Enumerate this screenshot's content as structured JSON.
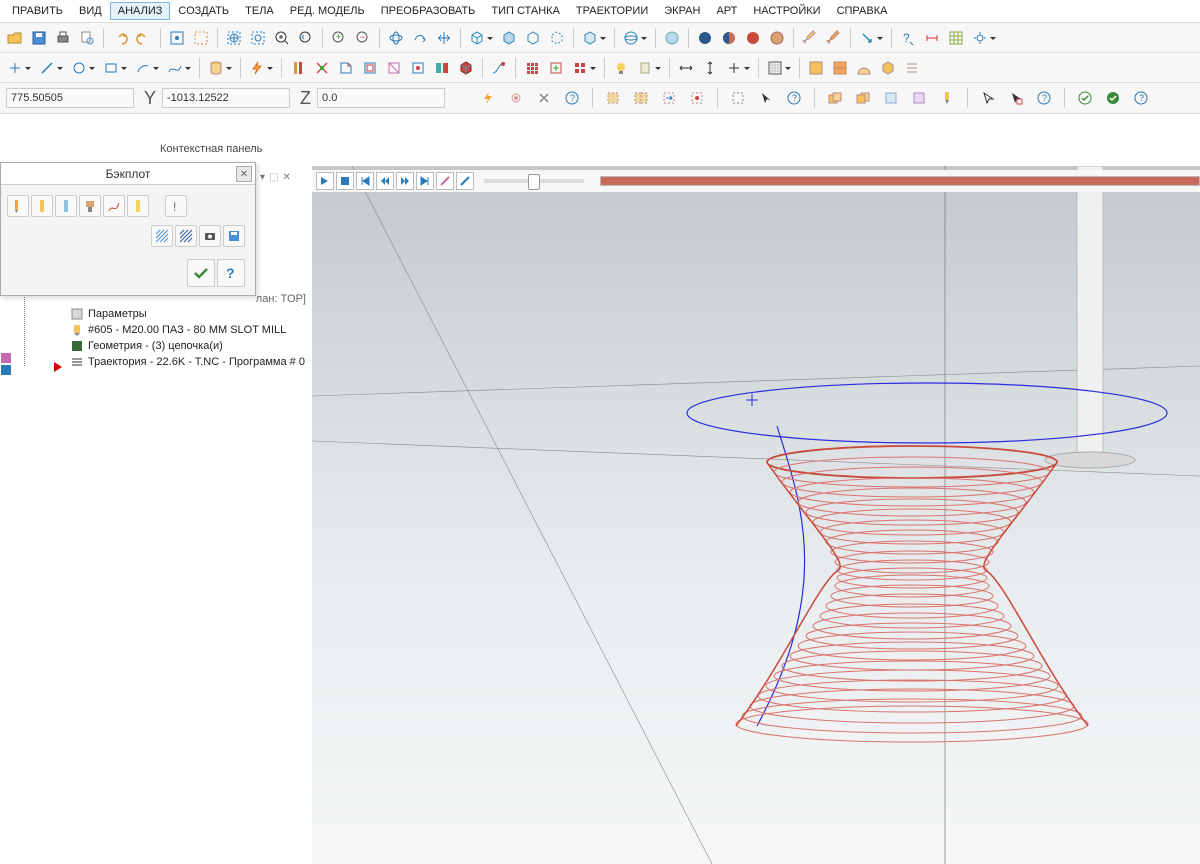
{
  "menubar": {
    "items": [
      "ПРАВИТЬ",
      "ВИД",
      "АНАЛИЗ",
      "СОЗДАТЬ",
      "ТЕЛА",
      "РЕД. МОДЕЛЬ",
      "ПРЕОБРАЗОВАТЬ",
      "ТИП СТАНКА",
      "ТРАЕКТОРИИ",
      "ЭКРАН",
      "АРТ",
      "НАСТРОЙКИ",
      "СПРАВКА"
    ],
    "active_index": 2
  },
  "coords": {
    "x": "775.50505",
    "y": "-1013.12522",
    "z": "0.0",
    "x_label": "",
    "y_label": "Y",
    "z_label": "Z"
  },
  "context_panel": {
    "label": "Контекстная панель"
  },
  "backplot": {
    "title": "Бэкплот",
    "tree_suffix": "лан: TOP]"
  },
  "tree": {
    "rows": [
      {
        "icon": "params",
        "label": "Параметры"
      },
      {
        "icon": "tool",
        "label": "#605 - M20.00 ПАЗ - 80 MM SLOT MILL"
      },
      {
        "icon": "geom",
        "label": "Геометрия - (3) цепочка(и)"
      },
      {
        "icon": "path",
        "label": "Траектория - 22.6K - T.NC - Программа # 0"
      }
    ]
  },
  "tabstrip": {
    "items": [
      "▾",
      "⬚",
      "✕"
    ]
  },
  "colors": {
    "toolpath": "#d9736b",
    "guide": "#2a2ae0",
    "axis": "#555"
  }
}
